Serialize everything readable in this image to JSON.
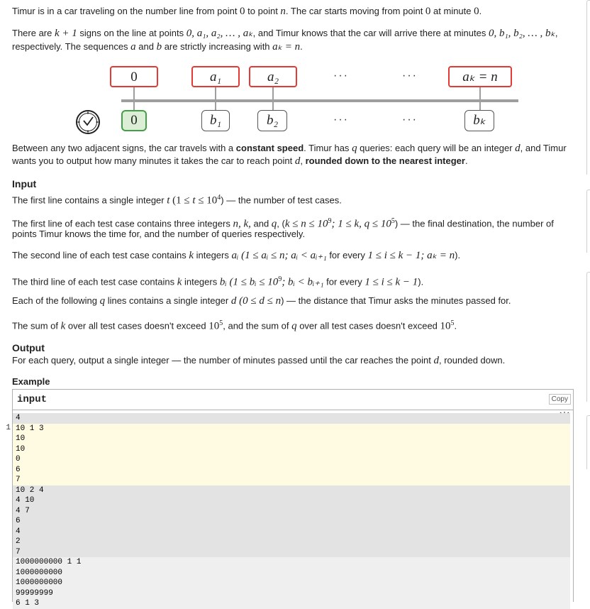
{
  "intro": {
    "l1a": "Timur is in a car traveling on the number line from point ",
    "l1b": "0",
    "l1c": " to point ",
    "l1d": "n",
    "l1e": ". The car starts moving from point ",
    "l1f": "0",
    "l1g": " at minute ",
    "l1h": "0",
    "l1i": ".",
    "l2a": "There are ",
    "l2b": "k + 1",
    "l2c": " signs on the line at points ",
    "l2d": "0, a₁, a₂, … , aₖ",
    "l2e": ", and Timur knows that the car will arrive there at minutes ",
    "l2f": "0, b₁, b₂, … , bₖ",
    "l2g": ",",
    "l3a": "respectively. The sequences ",
    "l3b": "a",
    "l3c": " and ",
    "l3d": "b",
    "l3e": " are strictly increasing with ",
    "l3f": "aₖ = n",
    "l3g": "."
  },
  "diagram": {
    "top": [
      "0",
      "a₁",
      "a₂",
      "···",
      "···",
      "aₖ = n"
    ],
    "bottom": [
      "0",
      "b₁",
      "b₂",
      "···",
      "···",
      "bₖ"
    ]
  },
  "between": {
    "a": "Between any two adjacent signs, the car travels with a ",
    "b": "constant speed",
    "c": ". Timur has ",
    "d": "q",
    "e": " queries: each query will be an integer ",
    "f": "d",
    "g": ", and Timur",
    "h": "wants you to output how many minutes it takes the car to reach point ",
    "i": "d",
    "j": ", ",
    "k": "rounded down to the nearest integer",
    "l": "."
  },
  "input": {
    "heading": "Input",
    "p1a": "The first line contains a single integer ",
    "p1b": "t",
    "p1c": " (1 ≤ ",
    "p1d": "t",
    "p1e": " ≤ 10",
    "p1f": "4",
    "p1g": ") — the number of test cases.",
    "p2a": "The first line of each test case contains three integers ",
    "p2b": "n, k,",
    "p2c": " and ",
    "p2d": "q",
    "p2e": ", (",
    "p2f": "k ≤ n ≤ 10",
    "p2g": "9",
    "p2h": "; 1 ≤ k, q ≤ 10",
    "p2i": "5",
    "p2j": ") — the final destination, the number of",
    "p2k": "points Timur knows the time for, and the number of queries respectively.",
    "p3a": "The second line of each test case contains ",
    "p3b": "k",
    "p3c": " integers ",
    "p3d": "aᵢ",
    "p3e": " (1 ≤ aᵢ ≤ n; aᵢ < aᵢ₊₁",
    "p3f": " for every ",
    "p3g": "1 ≤ i ≤ k − 1; aₖ = n",
    "p3h": ").",
    "p4a": "The third line of each test case contains ",
    "p4b": "k",
    "p4c": " integers ",
    "p4d": "bᵢ",
    "p4e": " (1 ≤ bᵢ ≤ 10",
    "p4f": "9",
    "p4g": "; bᵢ < bᵢ₊₁",
    "p4h": " for every ",
    "p4i": "1 ≤ i ≤ k − 1",
    "p4j": ").",
    "p5a": "Each of the following ",
    "p5b": "q",
    "p5c": " lines contains a single integer ",
    "p5d": "d",
    "p5e": " (0 ≤ d ≤ n",
    "p5f": ") — the distance that Timur asks the minutes passed for.",
    "p6a": "The sum of ",
    "p6b": "k",
    "p6c": " over all test cases doesn't exceed ",
    "p6d": "10",
    "p6e": "5",
    "p6f": ", and the sum of ",
    "p6g": "q",
    "p6h": " over all test cases doesn't exceed ",
    "p6i": "10",
    "p6j": "5",
    "p6k": "."
  },
  "output": {
    "heading": "Output",
    "a": "For each query, output a single integer — the number of minutes passed until the car reaches the point ",
    "b": "d",
    "c": ", rounded down."
  },
  "example": {
    "heading": "Example",
    "title": "input",
    "copy": "Copy",
    "line_number": "1",
    "lines": [
      "4",
      "10 1 3",
      "10",
      "10",
      "0",
      "6",
      "7",
      "10 2 4",
      "4 10",
      "4 7",
      "6",
      "4",
      "2",
      "7",
      "1000000000 1 1",
      "1000000000",
      "1000000000",
      "99999999",
      "6 1 3"
    ]
  },
  "colors": {
    "highlight": "#fffbe3",
    "gray": "#e3e3e3",
    "light": "#efefef",
    "red_box": "#e53935",
    "green_box": "#43a047"
  }
}
